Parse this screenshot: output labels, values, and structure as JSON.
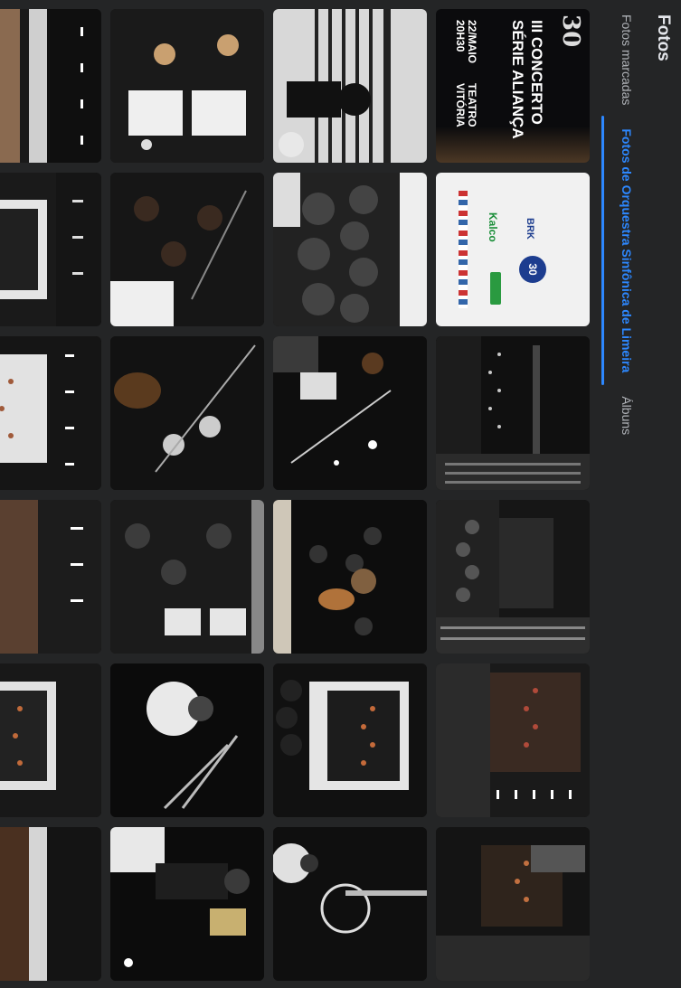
{
  "header": {
    "title": "Fotos"
  },
  "tabs": [
    {
      "label": "Fotos marcadas",
      "active": false
    },
    {
      "label": "Fotos de Orquestra Sinfônica de Limeira",
      "active": true
    },
    {
      "label": "Álbuns",
      "active": false
    }
  ],
  "poster": {
    "logo": "30",
    "line1": "III CONCERTO",
    "line2": "SÉRIE ALIANÇA",
    "date": "22/MAIO",
    "time": "20H30",
    "venue1": "TEATRO",
    "venue2": "VITÓRIA"
  },
  "sponsor": {
    "logo1": "BRK",
    "logo2": "30",
    "logo3": "Kalco"
  },
  "colors": {
    "accent": "#2d88ff",
    "background": "#242526",
    "text": "#e4e6eb",
    "muted": "#b0b3b8"
  }
}
